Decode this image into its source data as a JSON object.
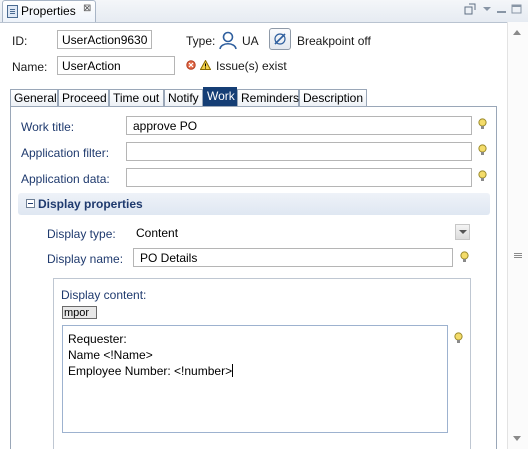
{
  "view": {
    "title": "Properties",
    "close_glyph": "⊠",
    "toolbar_icons": [
      "pin-icon",
      "view-menu-icon",
      "minimize-icon",
      "maximize-icon"
    ]
  },
  "header": {
    "id_label": "ID:",
    "id_value": "UserAction9630",
    "type_label": "Type:",
    "type_value": "UA",
    "breakpoint_label": "Breakpoint off",
    "name_label": "Name:",
    "name_value": "UserAction",
    "issues_text": "Issue(s) exist"
  },
  "tabs": [
    {
      "label": "General"
    },
    {
      "label": "Proceed"
    },
    {
      "label": "Time out"
    },
    {
      "label": "Notify"
    },
    {
      "label": "Work"
    },
    {
      "label": "Reminders"
    },
    {
      "label": "Description"
    }
  ],
  "active_tab": "Work",
  "work": {
    "work_title_label": "Work title:",
    "work_title_value": "approve PO",
    "app_filter_label": "Application filter:",
    "app_filter_value": "",
    "app_data_label": "Application data:",
    "app_data_value": ""
  },
  "display": {
    "section_title": "Display properties",
    "display_type_label": "Display type:",
    "display_type_value": "Content",
    "display_name_label": "Display name:",
    "display_name_value": "PO Details",
    "display_content_label": "Display content:",
    "chip_text": "mpor",
    "content_lines": [
      "Requester:",
      "Name <!Name>",
      "Employee Number: <!number>"
    ]
  },
  "colors": {
    "active_tab": "#153e75",
    "label_blue": "#1f3a6e",
    "bulb": "#e8c54a"
  }
}
